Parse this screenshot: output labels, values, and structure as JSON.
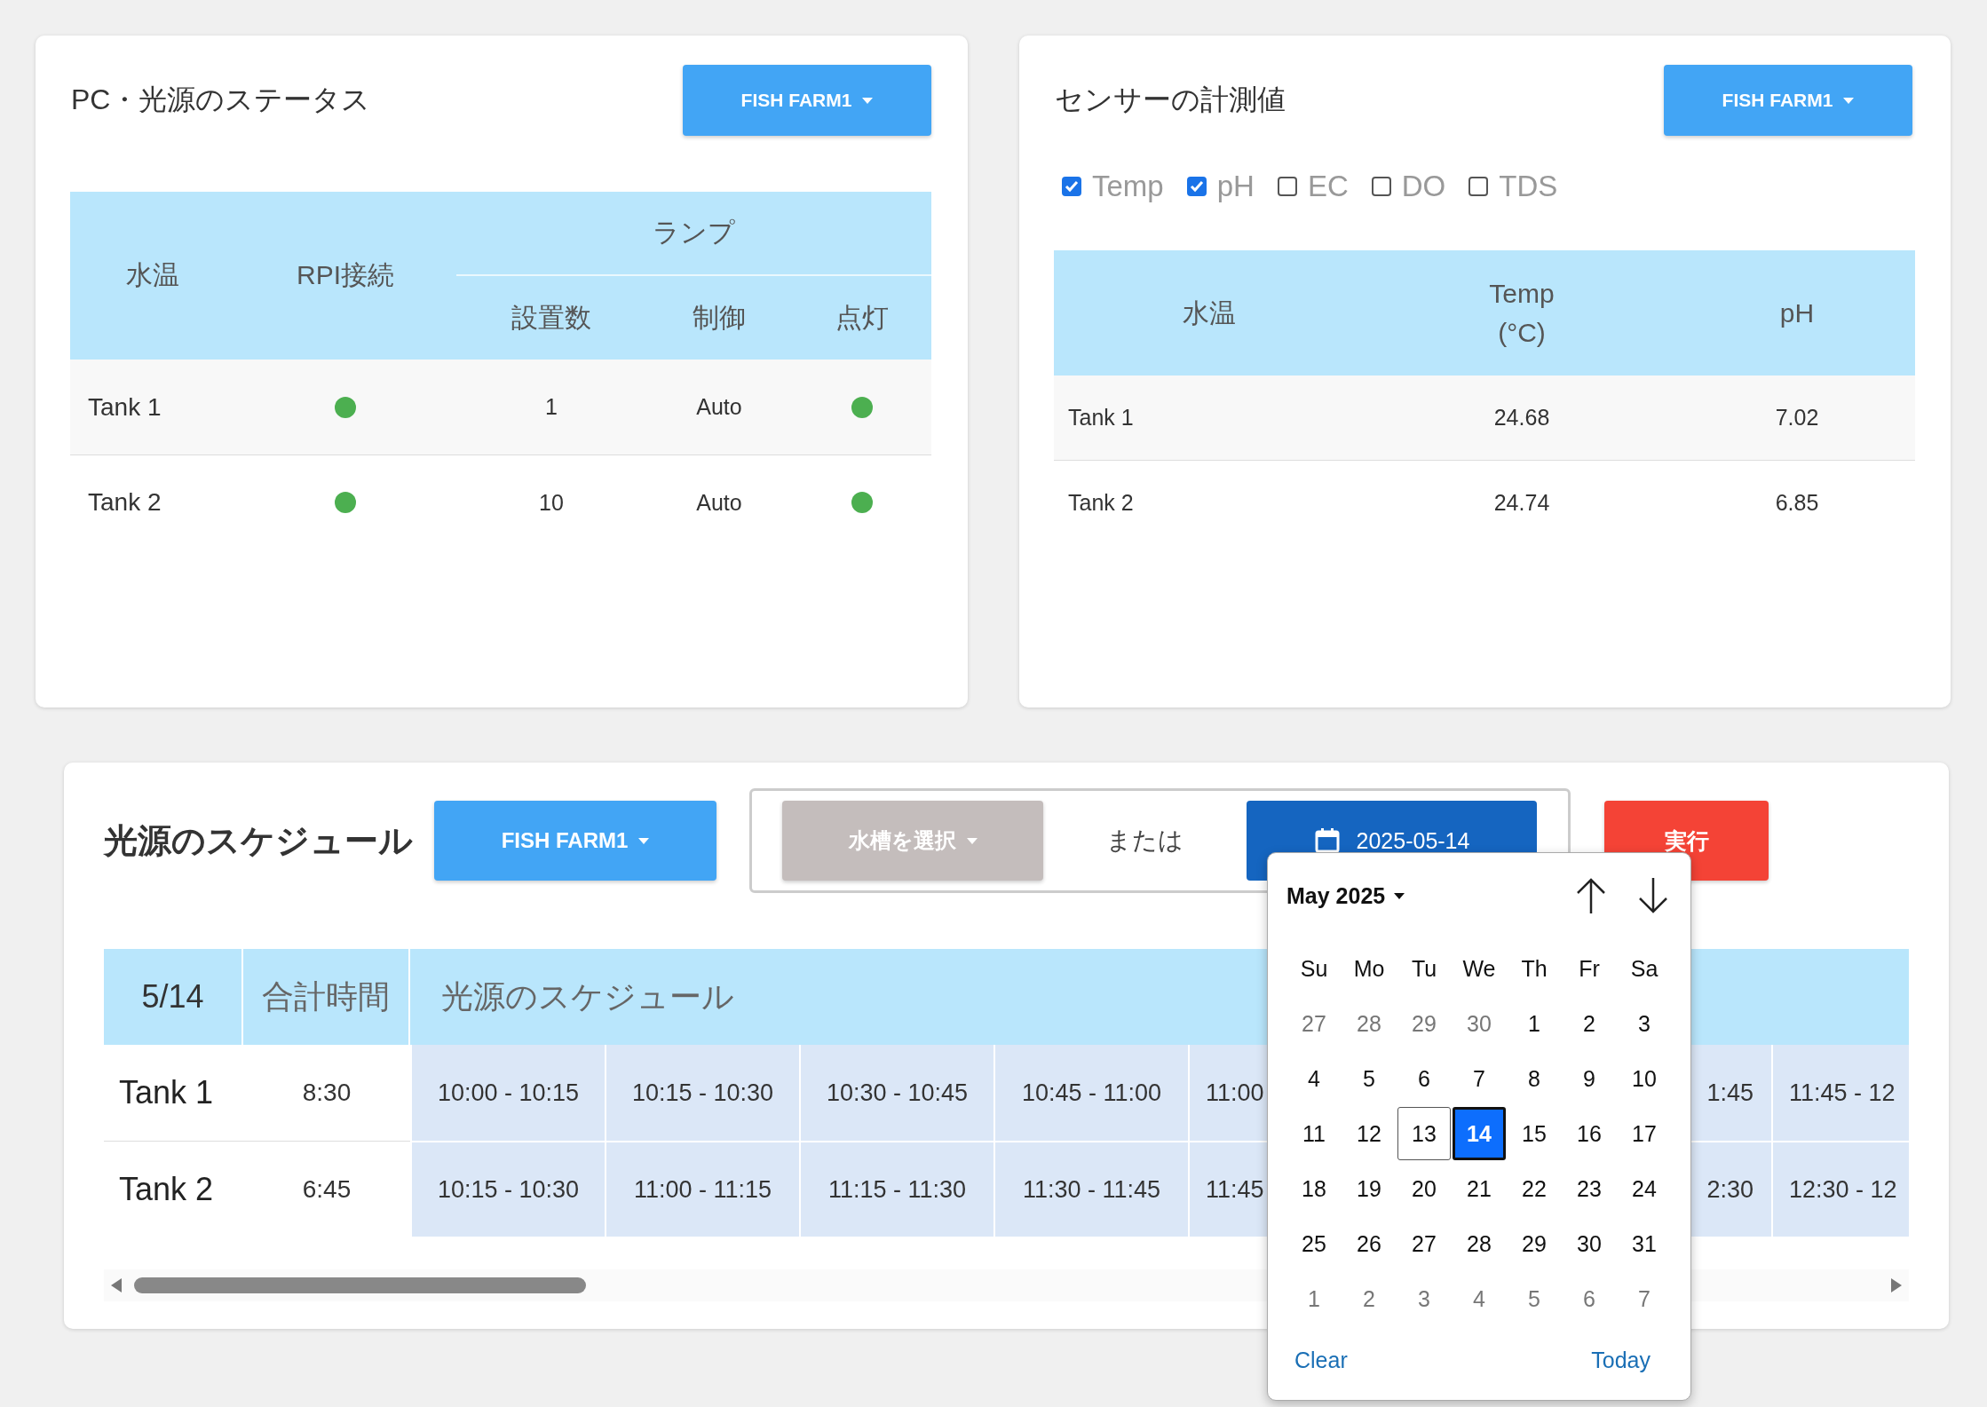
{
  "status": {
    "title": "PC・光源のステータス",
    "farm_button": "FISH FARM1",
    "header": {
      "tank": "水温",
      "rpi": "RPI接続",
      "lamp": "ランプ",
      "lamp_columns": [
        "設置数",
        "制御",
        "点灯"
      ]
    },
    "rows": [
      {
        "name": "Tank 1",
        "connected": true,
        "count": "1",
        "control": "Auto",
        "lit": true
      },
      {
        "name": "Tank 2",
        "connected": true,
        "count": "10",
        "control": "Auto",
        "lit": true
      }
    ]
  },
  "sensors": {
    "title": "センサーの計測値",
    "farm_button": "FISH FARM1",
    "filters": [
      {
        "label": "Temp",
        "checked": true
      },
      {
        "label": "pH",
        "checked": true
      },
      {
        "label": "EC",
        "checked": false
      },
      {
        "label": "DO",
        "checked": false
      },
      {
        "label": "TDS",
        "checked": false
      }
    ],
    "columns": [
      "水温",
      "Temp\n(°C)",
      "pH"
    ],
    "rows": [
      [
        "Tank 1",
        "24.68",
        "7.02"
      ],
      [
        "Tank 2",
        "24.74",
        "6.85"
      ]
    ]
  },
  "schedule": {
    "title": "光源のスケジュール",
    "farm_button": "FISH FARM1",
    "tank_select": "水槽を選択",
    "or_text": "または",
    "date": "2025-05-14",
    "run_button": "実行",
    "header": {
      "date": "5/14",
      "total": "合計時間",
      "schedule": "光源のスケジュール"
    },
    "rows": [
      {
        "name": "Tank 1",
        "total": "8:30",
        "slots": [
          {
            "time": "10:00 - 10:15",
            "kind": "full"
          },
          {
            "time": "10:15 - 10:30",
            "kind": "full"
          },
          {
            "time": "10:30 - 10:45",
            "kind": "full"
          },
          {
            "time": "10:45 - 11:00",
            "kind": "full"
          },
          {
            "time": "11:00",
            "kind": "cut_end"
          },
          {
            "time": "1:45",
            "kind": "cut_start"
          },
          {
            "time": "11:45 - 12",
            "kind": "cut_end"
          }
        ]
      },
      {
        "name": "Tank 2",
        "total": "6:45",
        "slots": [
          {
            "time": "10:15 - 10:30",
            "kind": "full"
          },
          {
            "time": "11:00 - 11:15",
            "kind": "full"
          },
          {
            "time": "11:15 - 11:30",
            "kind": "full"
          },
          {
            "time": "11:30 - 11:45",
            "kind": "full"
          },
          {
            "time": "11:45",
            "kind": "cut_end"
          },
          {
            "time": "2:30",
            "kind": "cut_start"
          },
          {
            "time": "12:30 - 12",
            "kind": "cut_end"
          }
        ]
      }
    ]
  },
  "calendar": {
    "month": "May 2025",
    "weekdays": [
      "Su",
      "Mo",
      "Tu",
      "We",
      "Th",
      "Fr",
      "Sa"
    ],
    "days": [
      {
        "label": "27",
        "outside": true,
        "selected": false,
        "today": false
      },
      {
        "label": "28",
        "outside": true,
        "selected": false,
        "today": false
      },
      {
        "label": "29",
        "outside": true,
        "selected": false,
        "today": false
      },
      {
        "label": "30",
        "outside": true,
        "selected": false,
        "today": false
      },
      {
        "label": "1",
        "outside": false,
        "selected": false,
        "today": false
      },
      {
        "label": "2",
        "outside": false,
        "selected": false,
        "today": false
      },
      {
        "label": "3",
        "outside": false,
        "selected": false,
        "today": false
      },
      {
        "label": "4",
        "outside": false,
        "selected": false,
        "today": false
      },
      {
        "label": "5",
        "outside": false,
        "selected": false,
        "today": false
      },
      {
        "label": "6",
        "outside": false,
        "selected": false,
        "today": false
      },
      {
        "label": "7",
        "outside": false,
        "selected": false,
        "today": false
      },
      {
        "label": "8",
        "outside": false,
        "selected": false,
        "today": false
      },
      {
        "label": "9",
        "outside": false,
        "selected": false,
        "today": false
      },
      {
        "label": "10",
        "outside": false,
        "selected": false,
        "today": false
      },
      {
        "label": "11",
        "outside": false,
        "selected": false,
        "today": false
      },
      {
        "label": "12",
        "outside": false,
        "selected": false,
        "today": false
      },
      {
        "label": "13",
        "outside": false,
        "selected": false,
        "today": true
      },
      {
        "label": "14",
        "outside": false,
        "selected": true,
        "today": false
      },
      {
        "label": "15",
        "outside": false,
        "selected": false,
        "today": false
      },
      {
        "label": "16",
        "outside": false,
        "selected": false,
        "today": false
      },
      {
        "label": "17",
        "outside": false,
        "selected": false,
        "today": false
      },
      {
        "label": "18",
        "outside": false,
        "selected": false,
        "today": false
      },
      {
        "label": "19",
        "outside": false,
        "selected": false,
        "today": false
      },
      {
        "label": "20",
        "outside": false,
        "selected": false,
        "today": false
      },
      {
        "label": "21",
        "outside": false,
        "selected": false,
        "today": false
      },
      {
        "label": "22",
        "outside": false,
        "selected": false,
        "today": false
      },
      {
        "label": "23",
        "outside": false,
        "selected": false,
        "today": false
      },
      {
        "label": "24",
        "outside": false,
        "selected": false,
        "today": false
      },
      {
        "label": "25",
        "outside": false,
        "selected": false,
        "today": false
      },
      {
        "label": "26",
        "outside": false,
        "selected": false,
        "today": false
      },
      {
        "label": "27",
        "outside": false,
        "selected": false,
        "today": false
      },
      {
        "label": "28",
        "outside": false,
        "selected": false,
        "today": false
      },
      {
        "label": "29",
        "outside": false,
        "selected": false,
        "today": false
      },
      {
        "label": "30",
        "outside": false,
        "selected": false,
        "today": false
      },
      {
        "label": "31",
        "outside": false,
        "selected": false,
        "today": false
      },
      {
        "label": "1",
        "outside": true,
        "selected": false,
        "today": false
      },
      {
        "label": "2",
        "outside": true,
        "selected": false,
        "today": false
      },
      {
        "label": "3",
        "outside": true,
        "selected": false,
        "today": false
      },
      {
        "label": "4",
        "outside": true,
        "selected": false,
        "today": false
      },
      {
        "label": "5",
        "outside": true,
        "selected": false,
        "today": false
      },
      {
        "label": "6",
        "outside": true,
        "selected": false,
        "today": false
      },
      {
        "label": "7",
        "outside": true,
        "selected": false,
        "today": false
      }
    ],
    "clear": "Clear",
    "today_button": "Today"
  }
}
